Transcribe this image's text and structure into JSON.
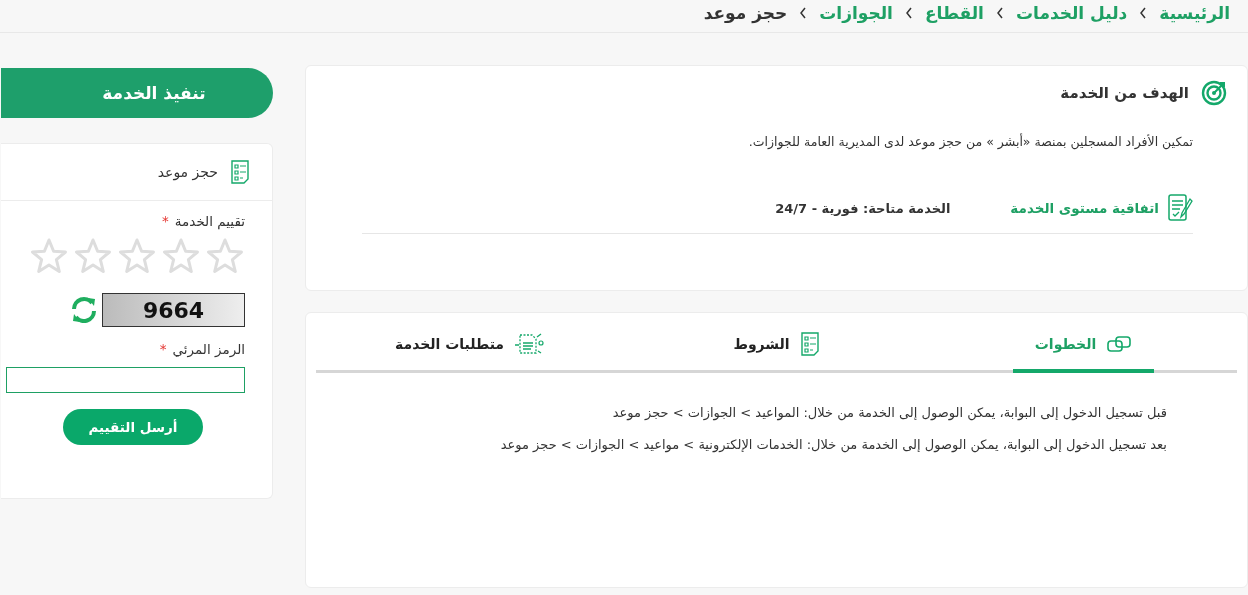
{
  "breadcrumb": [
    {
      "label": "الرئيسية",
      "current": false
    },
    {
      "label": "دليل الخدمات",
      "current": false
    },
    {
      "label": "القطاع",
      "current": false
    },
    {
      "label": "الجوازات",
      "current": false
    },
    {
      "label": "حجز موعد",
      "current": true
    }
  ],
  "goal": {
    "title": "الهدف من الخدمة",
    "description": "تمكين الأفراد المسجلين بمنصة «أبشر » من حجز موعد لدى المديرية العامة للجوازات.",
    "sla_link": "اتفاقية مستوى الخدمة",
    "availability": "الخدمة متاحة: فورية - 24/7"
  },
  "tabs": [
    {
      "label": "الخطوات",
      "selected": true,
      "kind": "steps"
    },
    {
      "label": "الشروط",
      "selected": false,
      "kind": "terms"
    },
    {
      "label": "متطلبات الخدمة",
      "selected": false,
      "kind": "requirements"
    }
  ],
  "steps": [
    "قبل تسجيل الدخول إلى البوابة، يمكن الوصول إلى الخدمة من خلال: المواعيد > الجوازات > حجز موعد",
    "بعد تسجيل الدخول إلى البوابة، يمكن الوصول إلى الخدمة من خلال: الخدمات الإلكترونية  > مواعيد  > الجوازات  > حجز موعد"
  ],
  "execute_button": "تنفيذ الخدمة",
  "rating_card": {
    "title": "حجز موعد",
    "rating_label": "تقييم الخدمة",
    "required_mark": "*",
    "stars": 0,
    "captcha": "9664",
    "captcha_label": "الرمز المرئي",
    "captcha_required_mark": "*",
    "submit": "أرسل التقييم"
  }
}
